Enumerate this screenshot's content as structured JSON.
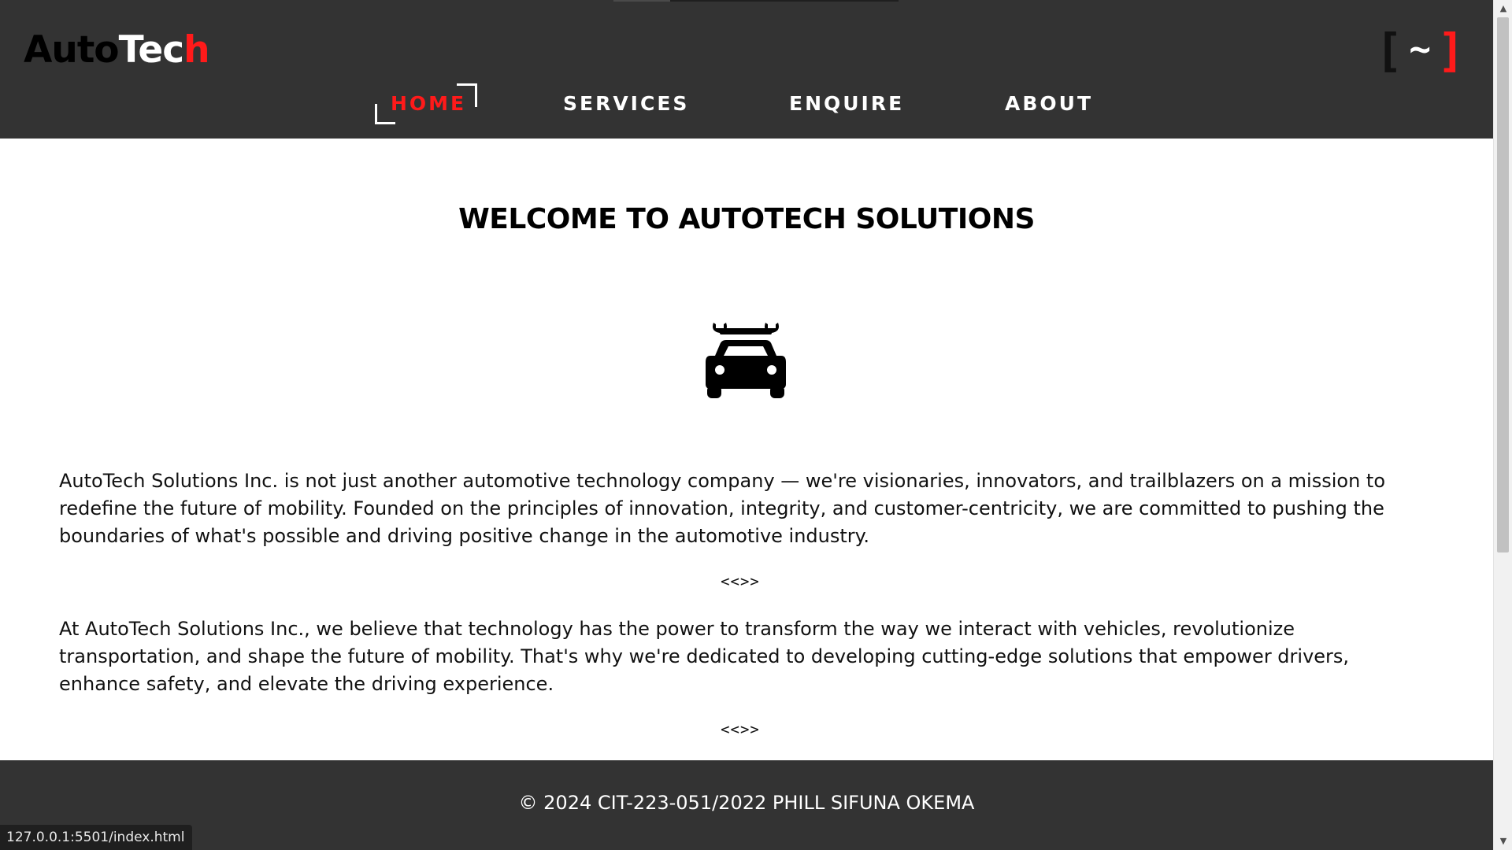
{
  "header": {
    "logo": {
      "part1": "Auto",
      "part2": "Tec",
      "part3": "h"
    },
    "menu_toggle": {
      "left": "[",
      "middle": "~",
      "right": "]"
    },
    "nav": [
      {
        "label": "HOME",
        "active": true
      },
      {
        "label": "SERVICES",
        "active": false
      },
      {
        "label": "ENQUIRE",
        "active": false
      },
      {
        "label": "ABOUT",
        "active": false
      }
    ]
  },
  "main": {
    "title": "WELCOME TO AUTOTECH SOLUTIONS",
    "hero_icon": "car-repair-icon",
    "paragraphs": [
      "AutoTech Solutions Inc. is not just another automotive technology company — we're visionaries, innovators, and trailblazers on a mission to redefine the future of mobility. Founded on the principles of innovation, integrity, and customer-centricity, we are committed to pushing the boundaries of what's possible and driving positive change in the automotive industry.",
      "At AutoTech Solutions Inc., we believe that technology has the power to transform the way we interact with vehicles, revolutionize transportation, and shape the future of mobility. That's why we're dedicated to developing cutting-edge solutions that empower drivers, enhance safety, and elevate the driving experience."
    ],
    "divider": "<<>>"
  },
  "footer": {
    "text": "© 2024  CIT-223-051/2022 PHILL SIFUNA OKEMA"
  },
  "status_bar": {
    "url": "127.0.0.1:5501/index.html"
  },
  "colors": {
    "header_bg": "#333333",
    "accent": "#ff1a1a",
    "text_light": "#ffffff",
    "text_dark": "#000000"
  }
}
